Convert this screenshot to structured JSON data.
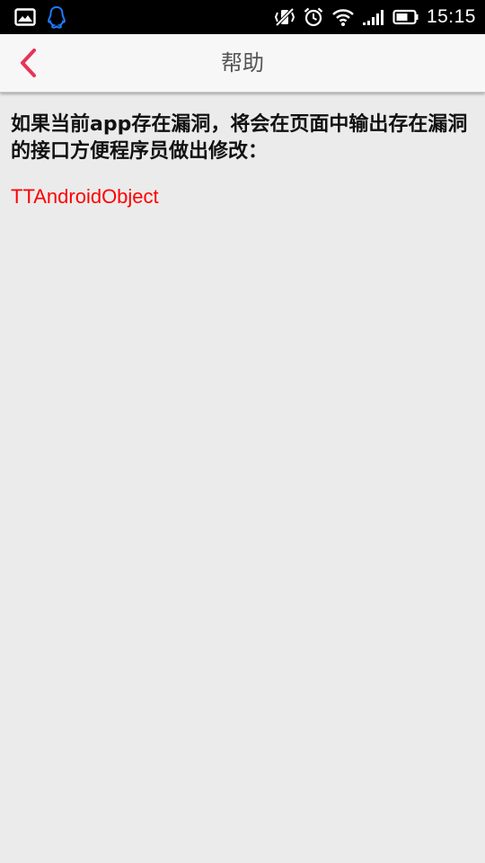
{
  "status_bar": {
    "time": "15:15",
    "left_icons": [
      "gallery-icon",
      "qq-icon"
    ],
    "right_icons": [
      "vibrate-off-icon",
      "alarm-icon",
      "wifi-icon",
      "signal-icon",
      "battery-icon"
    ]
  },
  "app_bar": {
    "title": "帮助",
    "back_icon": "chevron-left-icon",
    "accent_color": "#e8335a"
  },
  "content": {
    "description": "如果当前app存在漏洞，将会在页面中输出存在漏洞的接口方便程序员做出修改：",
    "vulnerable_interface": "TTAndroidObject",
    "result_color": "#ff0000"
  }
}
